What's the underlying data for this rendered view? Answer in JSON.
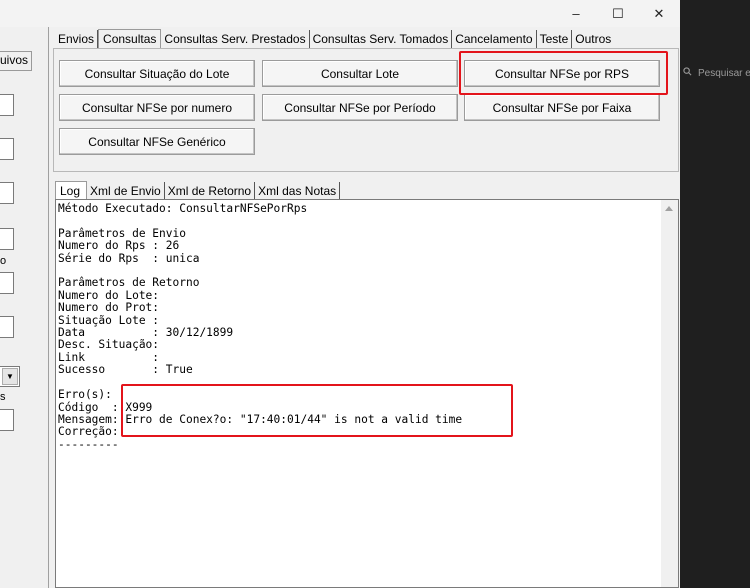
{
  "window": {
    "controls": {
      "minimize": "–",
      "maximize": "☐",
      "close": "✕"
    }
  },
  "left_panel": {
    "tab_fragment": "uivos",
    "label_o": "o",
    "label_s": "s"
  },
  "main_tabs": [
    "Envios",
    "Consultas",
    "Consultas Serv. Prestados",
    "Consultas Serv. Tomados",
    "Cancelamento",
    "Teste",
    "Outros"
  ],
  "active_tab": "Consultas",
  "buttons": {
    "consultar_situacao_lote": "Consultar Situação do Lote",
    "consultar_lote": "Consultar Lote",
    "consultar_nfse_rps": "Consultar NFSe por RPS",
    "consultar_nfse_numero": "Consultar NFSe por numero",
    "consultar_nfse_periodo": "Consultar NFSe por Período",
    "consultar_nfse_faixa": "Consultar NFSe por Faixa",
    "consultar_nfse_generico": "Consultar NFSe Genérico"
  },
  "log_tabs": [
    "Log",
    "Xml de Envio",
    "Xml de Retorno",
    "Xml das Notas"
  ],
  "log_text": "Método Executado: ConsultarNFSePorRps\n\nParâmetros de Envio\nNumero do Rps : 26\nSérie do Rps  : unica\n\nParâmetros de Retorno\nNumero do Lote:\nNumero do Prot:\nSituação Lote :\nData          : 30/12/1899\nDesc. Situação:\nLink          :\nSucesso       : True\n\nErro(s):\nCódigo  : X999\nMensagem: Erro de Conex?o: \"17:40:01/44\" is not a valid time\nCorreção:\n---------",
  "background": {
    "search_placeholder": "Pesquisar e"
  },
  "colors": {
    "highlight": "#e3141b",
    "window_bg": "#f0f0f0",
    "dark_bg": "#1f1f1f"
  }
}
